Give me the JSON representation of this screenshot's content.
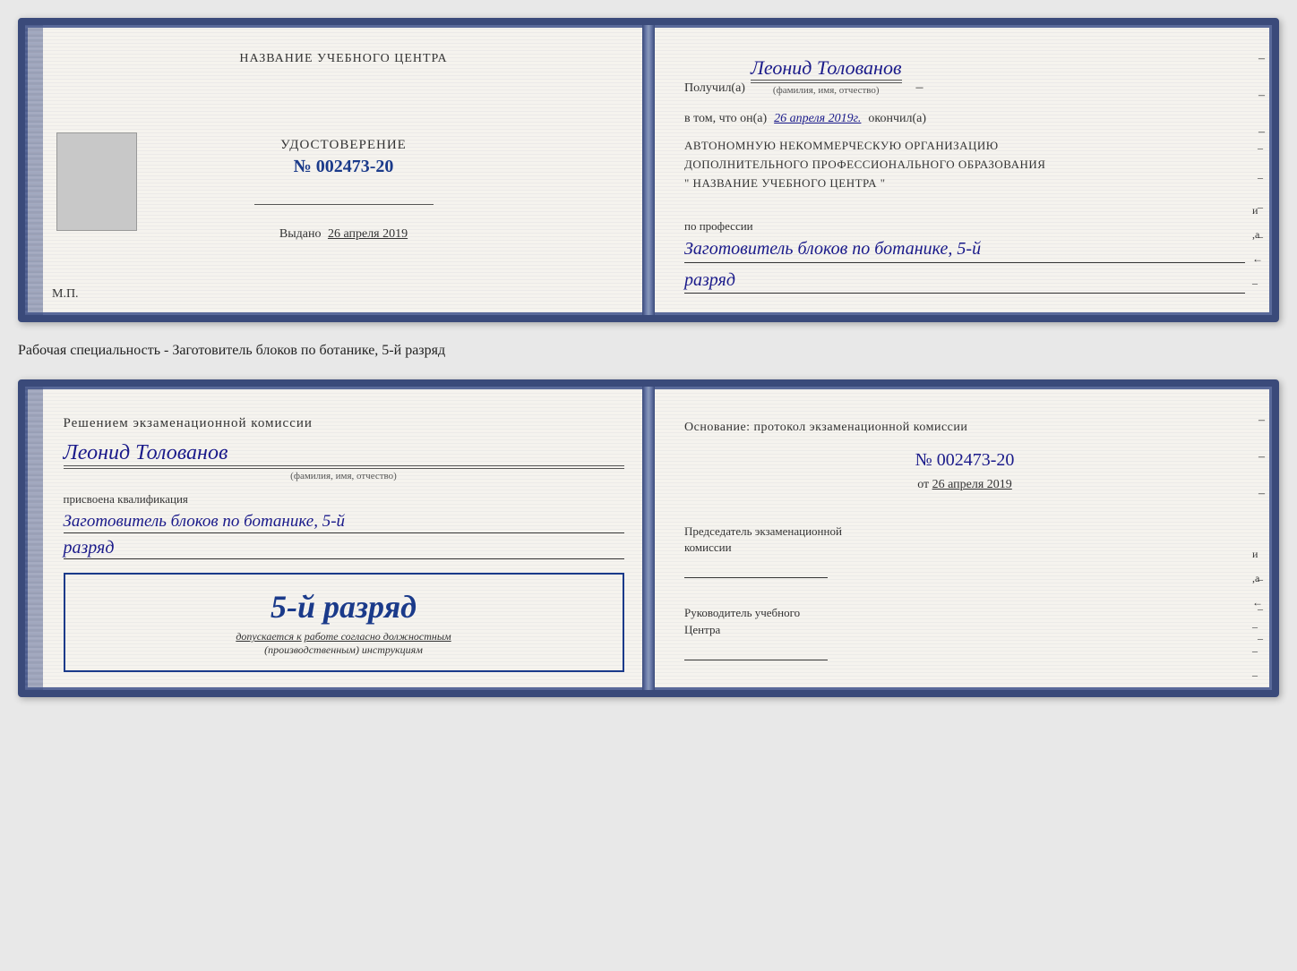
{
  "page": {
    "background": "#e8e8e8"
  },
  "top_card": {
    "left": {
      "training_center_label": "НАЗВАНИЕ УЧЕБНОГО ЦЕНТРА",
      "certificate_label": "УДОСТОВЕРЕНИЕ",
      "certificate_number": "№ 002473-20",
      "issued_prefix": "Выдано",
      "issued_date": "26 апреля 2019",
      "mp_label": "М.П."
    },
    "right": {
      "received_prefix": "Получил(а)",
      "recipient_name": "Леонид Толованов",
      "name_label": "(фамилия, имя, отчество)",
      "cert_text1": "в том, что он(а)",
      "cert_date": "26 апреля 2019г.",
      "cert_text2": "окончил(а)",
      "org_line1": "АВТОНОМНУЮ НЕКОММЕРЧЕСКУЮ ОРГАНИЗАЦИЮ",
      "org_line2": "ДОПОЛНИТЕЛЬНОГО ПРОФЕССИОНАЛЬНОГО ОБРАЗОВАНИЯ",
      "org_name": "\"   НАЗВАНИЕ УЧЕБНОГО ЦЕНТРА   \"",
      "profession_label": "по профессии",
      "profession_value": "Заготовитель блоков по ботанике, 5-й",
      "razryad_value": "разряд",
      "side_labels": [
        "и",
        "а",
        "←",
        "–",
        "–",
        "–",
        "–"
      ]
    }
  },
  "specialty_text": "Рабочая специальность - Заготовитель блоков по ботанике, 5-й разряд",
  "bottom_card": {
    "left": {
      "commission_line1": "Решением экзаменационной комиссии",
      "person_name": "Леонид Толованов",
      "name_label": "(фамилия, имя, отчество)",
      "qualification_prefix": "присвоена квалификация",
      "qualification_value": "Заготовитель блоков по ботанике, 5-й",
      "razryad_value": "разряд",
      "stamp_grade": "5-й разряд",
      "stamp_text": "допускается к",
      "stamp_underline": "работе согласно должностным",
      "stamp_italic": "(производственным) инструкциям"
    },
    "right": {
      "basis_text": "Основание: протокол экзаменационной комиссии",
      "protocol_number": "№  002473-20",
      "from_prefix": "от",
      "from_date": "26 апреля 2019",
      "chairman_line1": "Председатель экзаменационной",
      "chairman_line2": "комиссии",
      "director_line1": "Руководитель учебного",
      "director_line2": "Центра",
      "side_labels": [
        "и",
        "а",
        "←",
        "–",
        "–",
        "–",
        "–",
        "–"
      ]
    }
  }
}
